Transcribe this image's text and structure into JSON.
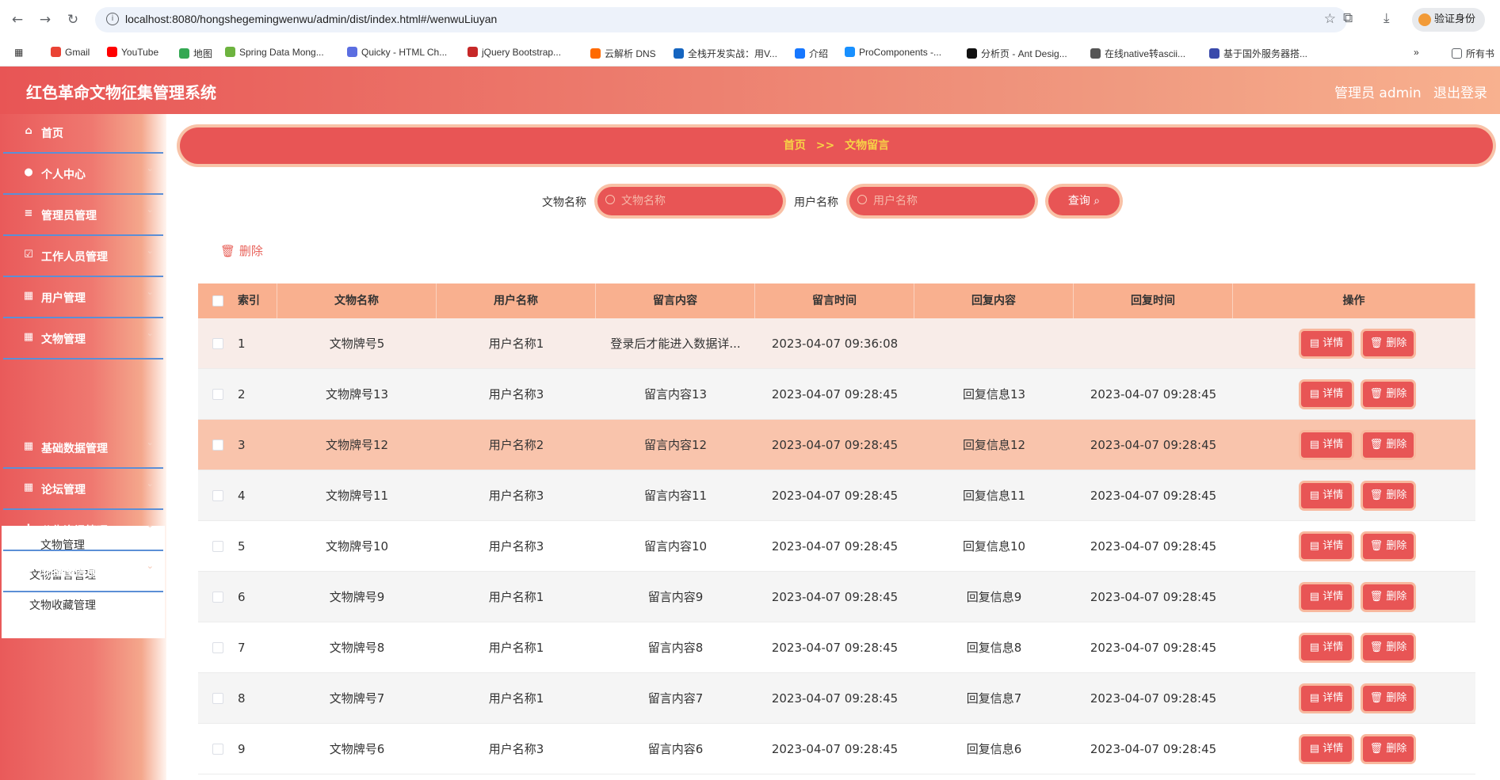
{
  "browser": {
    "url": "localhost:8080/hongshegemingwenwu/admin/dist/index.html#/wenwuLiuyan",
    "verify_label": "验证身份",
    "bookmarks": [
      {
        "label": "Gmail",
        "color": "#ea4335"
      },
      {
        "label": "YouTube",
        "color": "#ff0000"
      },
      {
        "label": "地图",
        "color": "#34a853"
      },
      {
        "label": "Spring Data Mong...",
        "color": "#6db33f"
      },
      {
        "label": "Quicky - HTML Ch...",
        "color": "#5b6ee1"
      },
      {
        "label": "jQuery Bootstrap...",
        "color": "#c62828"
      },
      {
        "label": "云解析 DNS",
        "color": "#ff6a00"
      },
      {
        "label": "全栈开发实战：用V...",
        "color": "#1565c0"
      },
      {
        "label": "介绍",
        "color": "#1677ff"
      },
      {
        "label": "ProComponents -...",
        "color": "#1890ff"
      },
      {
        "label": "分析页 - Ant Desig...",
        "color": "#111111"
      },
      {
        "label": "在线native转ascii...",
        "color": "#555555"
      },
      {
        "label": "基于国外服务器搭...",
        "color": "#3949ab"
      }
    ],
    "more_bookmarks": "所有书"
  },
  "header": {
    "title": "红色革命文物征集管理系统",
    "admin_label": "管理员 admin",
    "logout_label": "退出登录"
  },
  "sidebar": {
    "items": [
      {
        "label": "首页",
        "icon": "home-icon",
        "has_chevron": false
      },
      {
        "label": "个人中心",
        "icon": "user-icon",
        "has_chevron": true
      },
      {
        "label": "管理员管理",
        "icon": "menu-icon",
        "has_chevron": true
      },
      {
        "label": "工作人员管理",
        "icon": "check-square-icon",
        "has_chevron": true
      },
      {
        "label": "用户管理",
        "icon": "grid-icon",
        "has_chevron": true
      },
      {
        "label": "文物管理",
        "icon": "grid-icon",
        "has_chevron": true
      },
      {
        "label": "基础数据管理",
        "icon": "grid-icon",
        "has_chevron": true
      },
      {
        "label": "论坛管理",
        "icon": "grid-icon",
        "has_chevron": true
      },
      {
        "label": "公告资讯管理",
        "icon": "sliders-icon",
        "has_chevron": true
      },
      {
        "label": "轮播图信息",
        "icon": "monitor-icon",
        "has_chevron": true
      }
    ],
    "submenu": [
      "文物管理",
      "文物留言管理",
      "文物收藏管理"
    ]
  },
  "breadcrumb": {
    "home": "首页",
    "separator": ">>",
    "current": "文物留言"
  },
  "search": {
    "name_label": "文物名称",
    "name_placeholder": "文物名称",
    "user_label": "用户名称",
    "user_placeholder": "用户名称",
    "query_label": "查询"
  },
  "toolbar": {
    "delete_label": "删除"
  },
  "table": {
    "columns": [
      "索引",
      "文物名称",
      "用户名称",
      "留言内容",
      "留言时间",
      "回复内容",
      "回复时间",
      "操作"
    ],
    "detail_label": "详情",
    "delete_label": "删除",
    "rows": [
      {
        "index": "1",
        "name": "文物牌号5",
        "user": "用户名称1",
        "content": "登录后才能进入数据详...",
        "time": "2023-04-07 09:36:08",
        "reply": "",
        "reply_time": ""
      },
      {
        "index": "2",
        "name": "文物牌号13",
        "user": "用户名称3",
        "content": "留言内容13",
        "time": "2023-04-07 09:28:45",
        "reply": "回复信息13",
        "reply_time": "2023-04-07 09:28:45"
      },
      {
        "index": "3",
        "name": "文物牌号12",
        "user": "用户名称2",
        "content": "留言内容12",
        "time": "2023-04-07 09:28:45",
        "reply": "回复信息12",
        "reply_time": "2023-04-07 09:28:45"
      },
      {
        "index": "4",
        "name": "文物牌号11",
        "user": "用户名称3",
        "content": "留言内容11",
        "time": "2023-04-07 09:28:45",
        "reply": "回复信息11",
        "reply_time": "2023-04-07 09:28:45"
      },
      {
        "index": "5",
        "name": "文物牌号10",
        "user": "用户名称3",
        "content": "留言内容10",
        "time": "2023-04-07 09:28:45",
        "reply": "回复信息10",
        "reply_time": "2023-04-07 09:28:45"
      },
      {
        "index": "6",
        "name": "文物牌号9",
        "user": "用户名称1",
        "content": "留言内容9",
        "time": "2023-04-07 09:28:45",
        "reply": "回复信息9",
        "reply_time": "2023-04-07 09:28:45"
      },
      {
        "index": "7",
        "name": "文物牌号8",
        "user": "用户名称1",
        "content": "留言内容8",
        "time": "2023-04-07 09:28:45",
        "reply": "回复信息8",
        "reply_time": "2023-04-07 09:28:45"
      },
      {
        "index": "8",
        "name": "文物牌号7",
        "user": "用户名称1",
        "content": "留言内容7",
        "time": "2023-04-07 09:28:45",
        "reply": "回复信息7",
        "reply_time": "2023-04-07 09:28:45"
      },
      {
        "index": "9",
        "name": "文物牌号6",
        "user": "用户名称3",
        "content": "留言内容6",
        "time": "2023-04-07 09:28:45",
        "reply": "回复信息6",
        "reply_time": "2023-04-07 09:28:45"
      }
    ],
    "highlighted_row": 3
  },
  "colors": {
    "primary": "#e85555",
    "header_bg": "#f9b08f",
    "highlight_row": "#f9c4ac",
    "first_row": "#f8ece8",
    "stripe_row": "#f5f5f5"
  }
}
